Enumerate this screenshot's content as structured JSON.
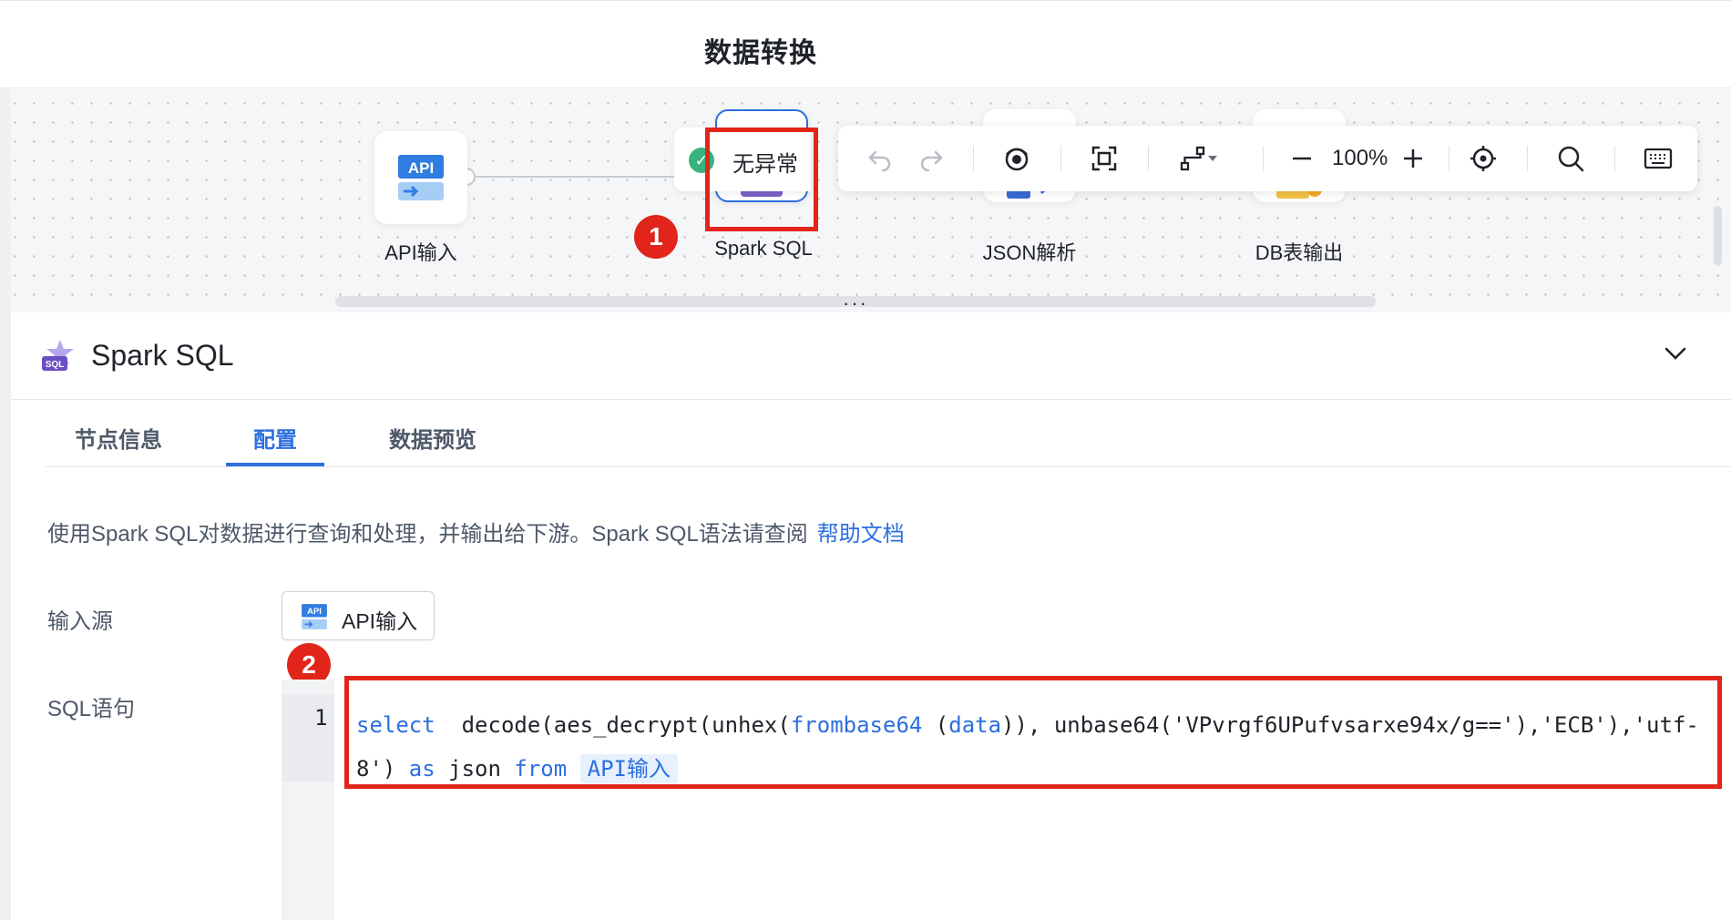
{
  "header": {
    "title": "数据转换"
  },
  "canvas": {
    "nodes": [
      {
        "label": "API输入",
        "icon": "api-input-icon"
      },
      {
        "label": "Spark SQL",
        "icon": "spark-sql-icon"
      },
      {
        "label": "JSON解析",
        "icon": "json-parse-icon"
      },
      {
        "label": "DB表输出",
        "icon": "db-output-icon"
      }
    ],
    "status": {
      "text": "无异常",
      "color": "#36b37e"
    },
    "toolbar": {
      "zoom": "100%"
    },
    "badges": [
      "1",
      "2"
    ]
  },
  "panel": {
    "title": "Spark SQL",
    "tabs": [
      {
        "label": "节点信息",
        "active": false
      },
      {
        "label": "配置",
        "active": true
      },
      {
        "label": "数据预览",
        "active": false
      }
    ],
    "description": "使用Spark SQL对数据进行查询和处理，并输出给下游。Spark SQL语法请查阅",
    "help_link": "帮助文档",
    "input_source": {
      "label": "输入源",
      "value": "API输入"
    },
    "sql": {
      "label": "SQL语句",
      "line_number": "1",
      "code": {
        "kw_select": "select",
        "part1": "  decode(aes_decrypt(unhex(",
        "fn_frombase64": "frombase64",
        "part2": " (",
        "fn_data": "data",
        "part3": ")), unbase64('VPvrgf6UPufvsarxe94x/g=='),'ECB'),'utf-8') ",
        "kw_as": "as",
        "part4": " json ",
        "kw_from": "from",
        "table": "API输入"
      }
    }
  },
  "colors": {
    "accent": "#2d6fdf",
    "alert": "#e1251b"
  }
}
